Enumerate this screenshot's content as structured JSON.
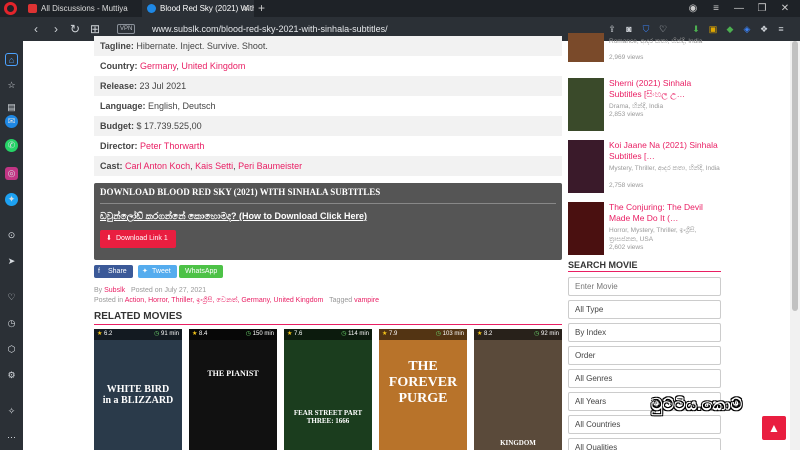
{
  "browser": {
    "tabs": [
      {
        "title": "All Discussions - Muttiya"
      },
      {
        "title": "Blood Red Sky (2021) With"
      }
    ],
    "new_tab": "+",
    "vpn_label": "VPN",
    "url": "www.subslk.com/blood-red-sky-2021-with-sinhala-subtitles/",
    "window_controls": [
      "—",
      "❐",
      "✕"
    ],
    "extra_icon": "≡"
  },
  "details": [
    {
      "label": "Tagline:",
      "value": "Hibernate. Inject. Survive. Shoot.",
      "links": []
    },
    {
      "label": "Country:",
      "value": "",
      "links": [
        "Germany",
        "United Kingdom"
      ]
    },
    {
      "label": "Release:",
      "value": "23 Jul 2021",
      "links": []
    },
    {
      "label": "Language:",
      "value": "English, Deutsch",
      "links": []
    },
    {
      "label": "Budget:",
      "value": "$ 17.739.525,00",
      "links": []
    },
    {
      "label": "Director:",
      "value": "",
      "links": [
        "Peter Thorwarth"
      ]
    },
    {
      "label": "Cast:",
      "value": "",
      "links": [
        "Carl Anton Koch",
        "Kais Setti",
        "Peri Baumeister"
      ]
    }
  ],
  "download": {
    "title": "DOWNLOAD BLOOD RED SKY (2021) WITH SINHALA SUBTITLES",
    "how_to": "ඩවුන්ලෝඩ් කරගන්නේ කොහොමද? (How to Download Click Here)",
    "button": "Download Link 1"
  },
  "share": {
    "facebook": "Share",
    "twitter": "Tweet",
    "whatsapp": "WhatsApp"
  },
  "meta": {
    "by": "By",
    "author": "Subslk",
    "posted_on": "Posted on July 27, 2021",
    "posted_in": "Posted in",
    "categories": "Action, Horror, Thriller, ඉංග්‍රීසි, වෙනත්, Germany, United Kingdom",
    "tagged": "Tagged",
    "tag": "vampire"
  },
  "related": {
    "heading": "RELATED MOVIES",
    "movies": [
      {
        "rating": "6.2",
        "duration": "91 min",
        "title": "WHITE BIRD\nin a BLIZZARD",
        "bg": "#2a3a4a"
      },
      {
        "rating": "8.4",
        "duration": "150 min",
        "title": "THE PIANIST",
        "bg": "#111111"
      },
      {
        "rating": "7.6",
        "duration": "114 min",
        "title": "FEAR STREET PART THREE: 1666",
        "bg": "#1b3d1e"
      },
      {
        "rating": "7.9",
        "duration": "103 min",
        "title": "THE FOREVER PURGE",
        "bg": "#b8732a"
      },
      {
        "rating": "8.2",
        "duration": "92 min",
        "title": "KINGDOM",
        "bg": "#5a4a3a"
      }
    ]
  },
  "sidebar_items": [
    {
      "title": "",
      "genre": "Romance, ආදර කතා, හින්දි, India",
      "views": "2,969 views",
      "thumb": "#7a4a2a"
    },
    {
      "title": "Sherni (2021) Sinhala Subtitles [සිංහල උ…",
      "genre": "Drama, හින්දි, India",
      "views": "2,853 views",
      "thumb": "#3a4a2a"
    },
    {
      "title": "Koi Jaane Na (2021) Sinhala Subtitles […",
      "genre": "Mystery, Thriller, ආදර කතා, හින්දි, India",
      "views": "2,758 views",
      "thumb": "#3a1a2a"
    },
    {
      "title": "The Conjuring: The Devil Made Me Do It (…",
      "genre": "Horror, Mystery, Thriller, ඉංග්‍රීසි, ත්‍රාසජනක, USA",
      "views": "2,602 views",
      "thumb": "#4a1010"
    }
  ],
  "search": {
    "heading": "SEARCH MOVIE",
    "placeholder": "Enter Movie",
    "selects": [
      "All Type",
      "By Index",
      "Order",
      "All Genres",
      "All Years",
      "All Countries",
      "All Qualities"
    ]
  },
  "watermark": "මුට්ටිය.කොම්",
  "to_top": "▲",
  "colors": {
    "accent": "#e91e63",
    "download_box": "#555555",
    "browser_dark": "#2b3036"
  }
}
